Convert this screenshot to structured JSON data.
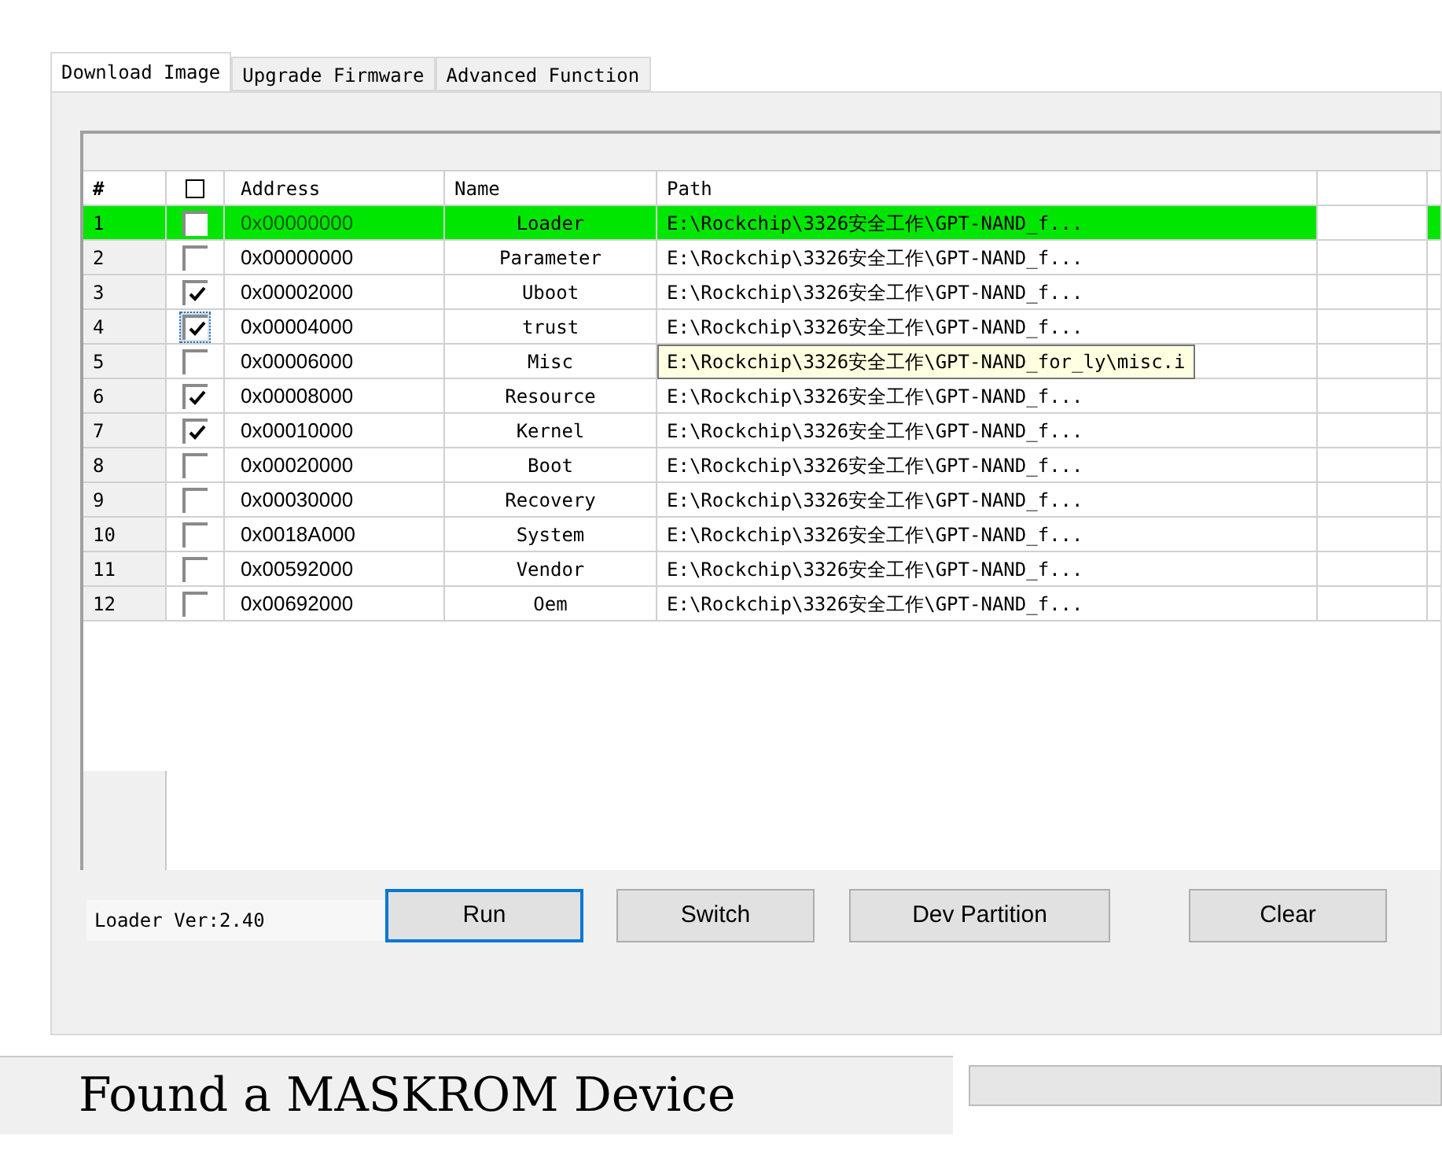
{
  "tabs": [
    {
      "label": "Download Image",
      "selected": true
    },
    {
      "label": "Upgrade Firmware",
      "selected": false
    },
    {
      "label": "Advanced Function",
      "selected": false
    }
  ],
  "table": {
    "columns": [
      "#",
      "Address",
      "Name",
      "Path"
    ],
    "header_checked": false,
    "rows": [
      {
        "index": "1",
        "checked": false,
        "selected": true,
        "focused": false,
        "tooltip": false,
        "address": "0x00000000",
        "name": "Loader",
        "path": "E:\\Rockchip\\3326安全工作\\GPT-NAND_f..."
      },
      {
        "index": "2",
        "checked": false,
        "selected": false,
        "focused": false,
        "tooltip": false,
        "address": "0x00000000",
        "name": "Parameter",
        "path": "E:\\Rockchip\\3326安全工作\\GPT-NAND_f..."
      },
      {
        "index": "3",
        "checked": true,
        "selected": false,
        "focused": false,
        "tooltip": false,
        "address": "0x00002000",
        "name": "Uboot",
        "path": "E:\\Rockchip\\3326安全工作\\GPT-NAND_f..."
      },
      {
        "index": "4",
        "checked": true,
        "selected": false,
        "focused": true,
        "tooltip": false,
        "address": "0x00004000",
        "name": "trust",
        "path": "E:\\Rockchip\\3326安全工作\\GPT-NAND_f..."
      },
      {
        "index": "5",
        "checked": false,
        "selected": false,
        "focused": false,
        "tooltip": true,
        "address": "0x00006000",
        "name": "Misc",
        "path": "E:\\Rockchip\\3326安全工作\\GPT-NAND_for_ly\\misc.i"
      },
      {
        "index": "6",
        "checked": true,
        "selected": false,
        "focused": false,
        "tooltip": false,
        "address": "0x00008000",
        "name": "Resource",
        "path": "E:\\Rockchip\\3326安全工作\\GPT-NAND_f..."
      },
      {
        "index": "7",
        "checked": true,
        "selected": false,
        "focused": false,
        "tooltip": false,
        "address": "0x00010000",
        "name": "Kernel",
        "path": "E:\\Rockchip\\3326安全工作\\GPT-NAND_f..."
      },
      {
        "index": "8",
        "checked": false,
        "selected": false,
        "focused": false,
        "tooltip": false,
        "address": "0x00020000",
        "name": "Boot",
        "path": "E:\\Rockchip\\3326安全工作\\GPT-NAND_f..."
      },
      {
        "index": "9",
        "checked": false,
        "selected": false,
        "focused": false,
        "tooltip": false,
        "address": "0x00030000",
        "name": "Recovery",
        "path": "E:\\Rockchip\\3326安全工作\\GPT-NAND_f..."
      },
      {
        "index": "10",
        "checked": false,
        "selected": false,
        "focused": false,
        "tooltip": false,
        "address": "0x0018A000",
        "name": "System",
        "path": "E:\\Rockchip\\3326安全工作\\GPT-NAND_f..."
      },
      {
        "index": "11",
        "checked": false,
        "selected": false,
        "focused": false,
        "tooltip": false,
        "address": "0x00592000",
        "name": "Vendor",
        "path": "E:\\Rockchip\\3326安全工作\\GPT-NAND_f..."
      },
      {
        "index": "12",
        "checked": false,
        "selected": false,
        "focused": false,
        "tooltip": false,
        "address": "0x00692000",
        "name": "Oem",
        "path": "E:\\Rockchip\\3326安全工作\\GPT-NAND_f..."
      }
    ]
  },
  "loader_version": "Loader Ver:2.40",
  "buttons": [
    {
      "label": "Run",
      "focused": true
    },
    {
      "label": "Switch",
      "focused": false
    },
    {
      "label": "Dev Partition",
      "focused": false
    },
    {
      "label": "Clear",
      "focused": false
    }
  ],
  "status": "Found a MASKROM Device",
  "progress": {
    "level": 0
  }
}
